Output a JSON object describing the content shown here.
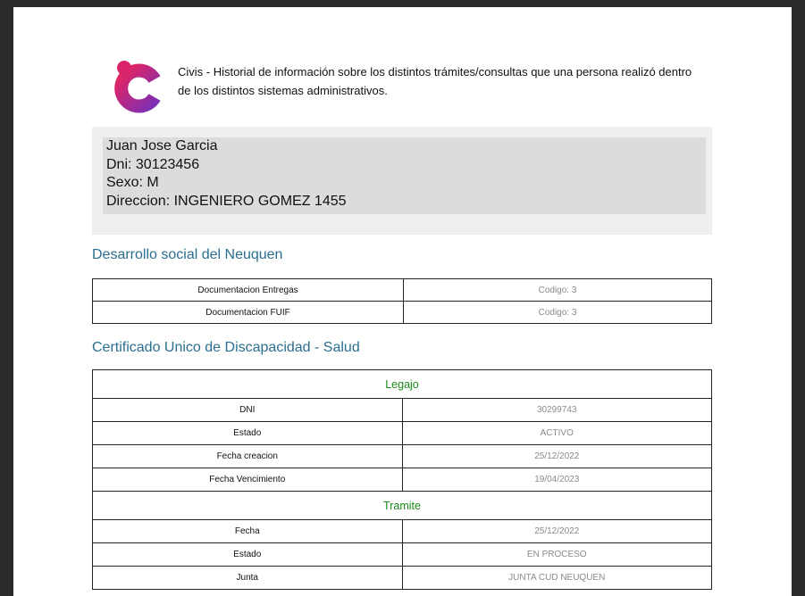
{
  "header": {
    "logo_name": "civis-logo",
    "description": "Civis - Historial de información sobre los distintos trámites/consultas que una persona realizó dentro de los distintos sistemas administrativos."
  },
  "person": {
    "name": "Juan Jose Garcia",
    "dni": "Dni: 30123456",
    "sexo": "Sexo: M",
    "direccion": "Direccion: INGENIERO GOMEZ 1455"
  },
  "sections": [
    {
      "title": "Desarrollo social del Neuquen",
      "rows": [
        {
          "label": "Documentacion Entregas",
          "value": "Codigo: 3"
        },
        {
          "label": "Documentacion FUIF",
          "value": "Codigo: 3"
        }
      ]
    },
    {
      "title": "Certificado Unico de Discapacidad - Salud",
      "groups": [
        {
          "heading": "Legajo",
          "rows": [
            {
              "label": "DNI",
              "value": "30299743"
            },
            {
              "label": "Estado",
              "value": "ACTIVO"
            },
            {
              "label": "Fecha creacion",
              "value": "25/12/2022"
            },
            {
              "label": "Fecha Vencimiento",
              "value": "19/04/2023"
            }
          ]
        },
        {
          "heading": "Tramite",
          "rows": [
            {
              "label": "Fecha",
              "value": "25/12/2022"
            },
            {
              "label": "Estado",
              "value": "EN PROCESO"
            },
            {
              "label": "Junta",
              "value": "JUNTA CUD NEUQUEN"
            }
          ]
        }
      ]
    }
  ],
  "colors": {
    "section_title": "#2a6f8f",
    "group_heading": "#1a8a1a",
    "value_text": "#8a8a8a",
    "logo_gradient": [
      "#e8245f",
      "#7a2fb5"
    ]
  }
}
